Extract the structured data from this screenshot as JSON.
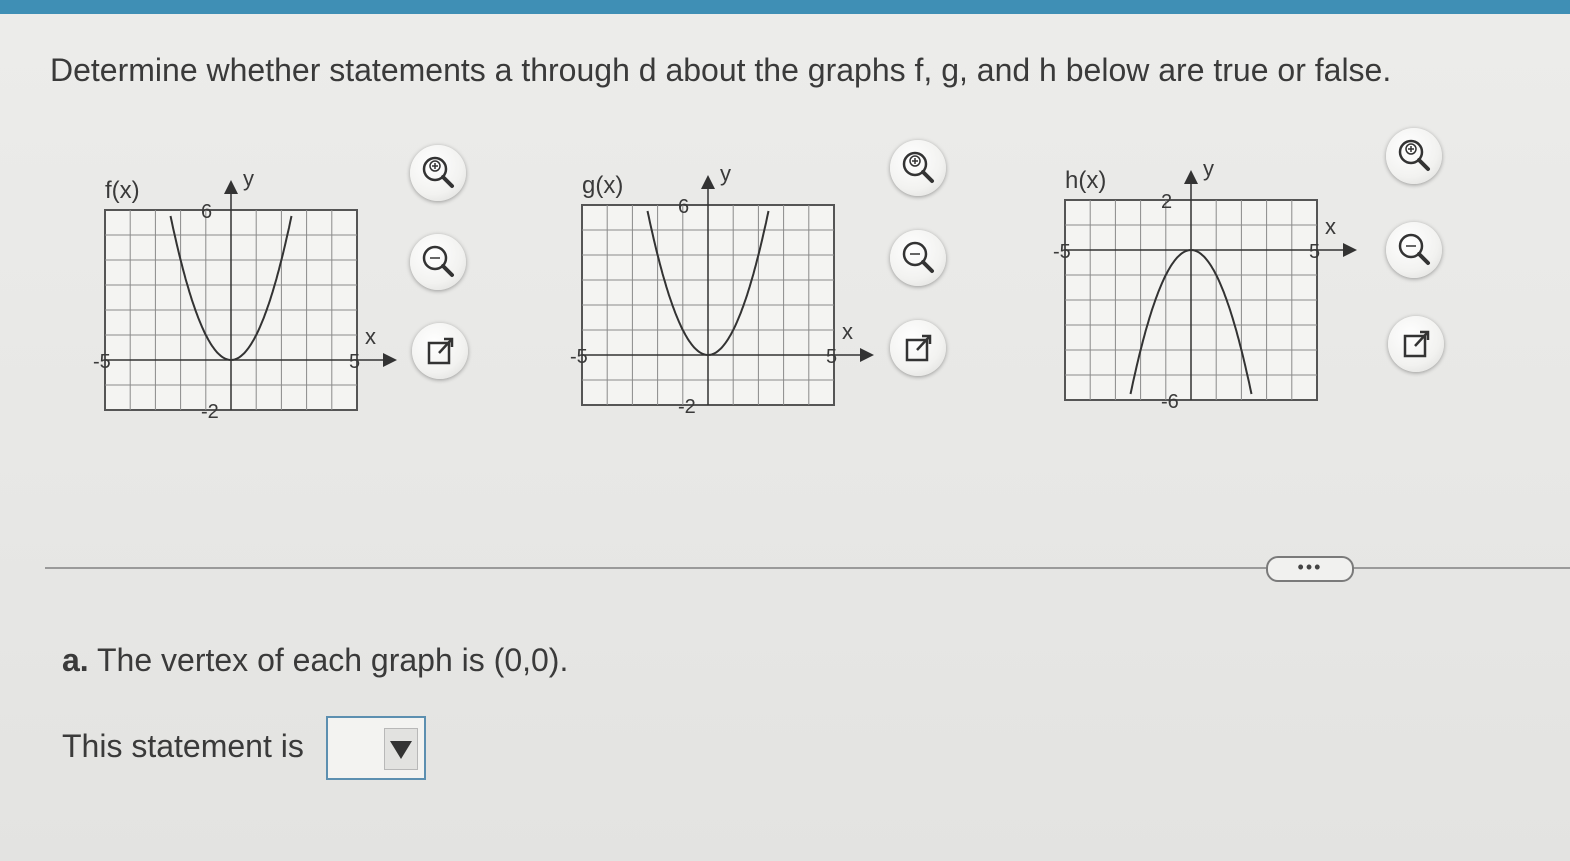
{
  "question": "Determine whether statements a through d about the graphs f, g, and h below are true or false.",
  "graphs": [
    {
      "label": "f(x)",
      "x_axis": "x",
      "y_axis": "y",
      "tick_labels": {
        "x_min": "-5",
        "x_max": "5",
        "y_top": "6",
        "y_bottom": "-2"
      },
      "chart_data": {
        "type": "line",
        "function": "(x)^2 + 0",
        "vertex": [
          0,
          0
        ],
        "opens": "up",
        "xlim": [
          -5,
          5
        ],
        "ylim": [
          -2,
          6
        ]
      }
    },
    {
      "label": "g(x)",
      "x_axis": "x",
      "y_axis": "y",
      "tick_labels": {
        "x_min": "-5",
        "x_max": "5",
        "y_top": "6",
        "y_bottom": "-2"
      },
      "chart_data": {
        "type": "line",
        "function": "(x)^2 + 0",
        "vertex": [
          0,
          0
        ],
        "opens": "up",
        "xlim": [
          -5,
          5
        ],
        "ylim": [
          -2,
          6
        ]
      }
    },
    {
      "label": "h(x)",
      "x_axis": "x",
      "y_axis": "y",
      "tick_labels": {
        "x_min": "-5",
        "x_max": "5",
        "y_top": "2",
        "y_bottom": "-6"
      },
      "chart_data": {
        "type": "line",
        "function": "-(x)^2 + 0",
        "vertex": [
          0,
          0
        ],
        "opens": "down",
        "xlim": [
          -5,
          5
        ],
        "ylim": [
          -6,
          2
        ]
      }
    }
  ],
  "tools": [
    "zoom-in-icon",
    "zoom-out-icon",
    "popout-icon"
  ],
  "more_label": "•••",
  "part_a": {
    "letter": "a.",
    "text": " The vertex of each graph is (0,0)."
  },
  "statement": {
    "label": "This statement is",
    "selected": ""
  }
}
